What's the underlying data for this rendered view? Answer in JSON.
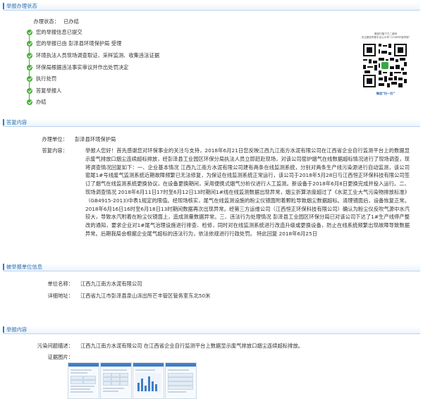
{
  "sections": {
    "status": "举报办理状态",
    "reply": "答复内容",
    "reported": "被举报单位信息",
    "content": "举报内容"
  },
  "status": {
    "label": "办理状态：",
    "value": "已办结",
    "steps": [
      "您的举报信息已提交",
      "您的举报已由 彭泽县环境保护局 受理",
      "环境执法人员现场调查取证、采样监测、收集违法证据",
      "环保局根据违法事实审议并作出处罚决定",
      "执行处罚",
      "答复举报人",
      "办结"
    ]
  },
  "qr": {
    "top_line1": "微信扫描下方二维码",
    "top_line2": "关注微信举报平台公众号“12369环保举报”",
    "bottom": "微信“扫一扫”"
  },
  "reply": {
    "unit_label": "办理单位：",
    "unit_value": "彭泽县环境保护局",
    "content_label": "答复内容：",
    "content_text": "举报人您好！首先感谢您对环保事业的关注与支持，2018年6月21日您反映江西九江南方水泥有限公司在江西省企业自行监测平台上的数据显示废气排放口烟尘连续超标排放，经彭泽县工业园区环保分局执法人员立即赶赴现场，对该公司窑炉烟气在线数据超标情况进行了现场调查，现将调查情况回复如下：一、企业基本情况 江西九江南方水泥有限公司建有两条在线监测系统，分别对两条生产线污染源进行自动监测，该公司窑尾1#号线废气监测系统近期故障频繁已无法修复，为保证在线监测系统正常运行，该公司于2018年5月28日与江西恒正环保科技有限公司签订了烟气在线监测系统更换协议，在设备更换期间，采用便携式烟气分析仪进行人工监测。新设备于2018年6月8日更换完成并投入运行。二、现场调查情况 2018年6月11日17时至6月12日13时期间1#线在线监测数据出现异常，烟尘折算浓度超过了《水泥工业大气污染物排放标准》（GB4915-2013)中表1规定的限值。经现场核实，尾气在线监测设施的粉尘仪镜面附着颗粒导致烟尘数据超标。清理镜面后，设备恢复正常。2018年6月16日16时至6月18日13时期间数据再次出现异常。经第三方运维公司（江西恒正环保科技有限公司）确认为粉尘仪反吹气源中水汽较大，导致水汽附着在粉尘仪镜面上，造成测量数据异常。三、违法行为处理情况 彭泽县工业园区环保分局已对该公司下达了1#生产线停产整改的通知，要求企业对1#尾气治理设施进行排查、检修，同时对在线监测系统进行改造升级或更换设备，防止在线系统频繁出现故障导致数据异常。后期我局会根据企业尾气超标的违法行为，依法依规进行行政处罚。 特此回复 2018年6月25日"
  },
  "reported": {
    "name_label": "单位名称：",
    "name_value": "江西九江南方水泥有限公司",
    "addr_label": "详细地址：",
    "addr_value": "江西省九江市彭泽县泉山派出所芒丰管区管务室东北50米"
  },
  "content": {
    "desc_label": "污染问题描述：",
    "desc_value": "江西九江南方水泥有限公司 在江西省企业自行监测平台上数据显示废气排放口烟尘连续超标排放。",
    "photos_label": "证据图片："
  },
  "colors": {
    "accent": "#2a7fc9",
    "check": "#4caf3c"
  }
}
